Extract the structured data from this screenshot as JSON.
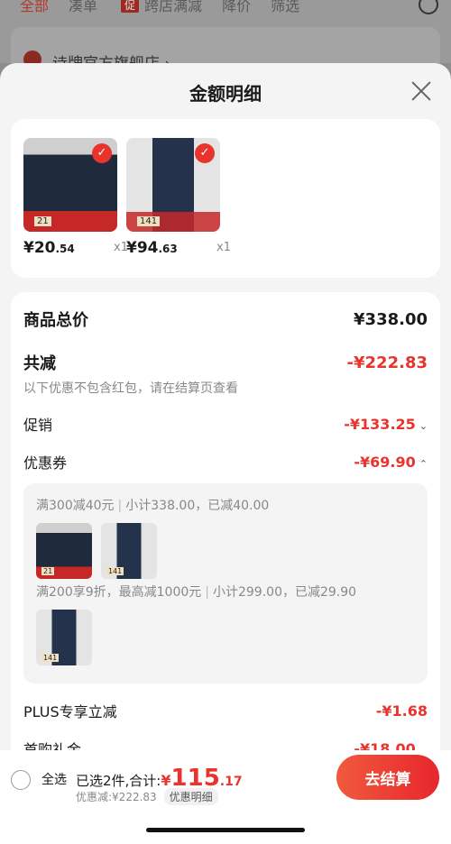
{
  "background": {
    "tabs": [
      "全部",
      "凑单",
      "跨店满减",
      "降价",
      "筛选"
    ],
    "tab_badge": "促",
    "store_name": "诗牌官方旗舰店 ›"
  },
  "sheet": {
    "title": "金额明细"
  },
  "products": [
    {
      "price_yen": "¥20",
      "price_dec": ".54",
      "qty": "x1",
      "tag": "21"
    },
    {
      "price_yen": "¥94",
      "price_dec": ".63",
      "qty": "x1",
      "tag": "141"
    }
  ],
  "detail": {
    "goods_total_label": "商品总价",
    "goods_total_value": "¥338.00",
    "total_discount_label": "共减",
    "total_discount_value": "-¥222.83",
    "note": "以下优惠不包含红包，请在结算页查看",
    "promo_label": "促销",
    "promo_value": "-¥133.25",
    "coupon_label": "优惠券",
    "coupon_value": "-¥69.90",
    "coupon_rules": [
      {
        "rule": "满300减40元",
        "sub": "小计338.00，已减40.00",
        "tags": [
          "21",
          "141"
        ]
      },
      {
        "rule": "满200享9折，最高减1000元",
        "sub": "小计299.00，已减29.90",
        "tags": [
          "141"
        ]
      }
    ],
    "plus_label": "PLUS专享立减",
    "plus_value": "-¥1.68",
    "first_label": "首购礼金",
    "first_value": "-¥18.00"
  },
  "bottom": {
    "select_all": "全选",
    "selected_text": "已选2件,合计:",
    "total_yen": "¥",
    "total_int": "115",
    "total_dec": ".17",
    "discount_text": "优惠减:¥222.83",
    "detail_pill": "优惠明细",
    "checkout": "去结算"
  },
  "colors": {
    "accent_red": "#e8342d",
    "sheet_bg": "#f4f4f4"
  }
}
